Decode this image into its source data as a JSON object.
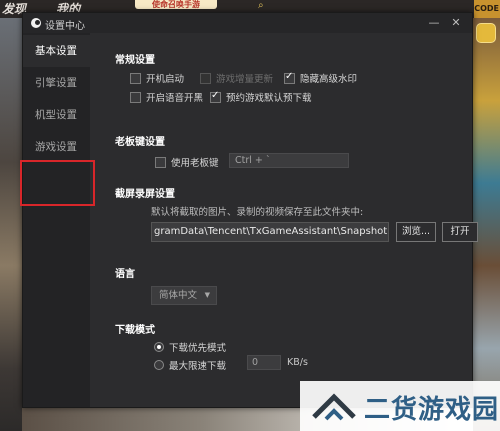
{
  "background": {
    "nav_items": [
      "发现",
      "我的"
    ],
    "banner": "使命召唤手游",
    "search_icon": "search-icon",
    "corner_logo": "CODE"
  },
  "window": {
    "title": "设置中心",
    "min_icon": "minimize-icon",
    "close_icon": "close-icon"
  },
  "sidebar": {
    "items": [
      {
        "label": "基本设置",
        "active": true
      },
      {
        "label": "引擎设置",
        "active": false
      },
      {
        "label": "机型设置",
        "active": false
      },
      {
        "label": "游戏设置",
        "active": false
      }
    ],
    "highlight_color": "#d8262a"
  },
  "general": {
    "title": "常规设置",
    "options": [
      {
        "label": "开机启动",
        "checked": false,
        "disabled": false
      },
      {
        "label": "游戏增量更新",
        "checked": false,
        "disabled": true
      },
      {
        "label": "隐藏高级水印",
        "checked": true,
        "disabled": false
      },
      {
        "label": "开启语音开黑",
        "checked": false,
        "disabled": false
      },
      {
        "label": "预约游戏默认预下载",
        "checked": true,
        "disabled": false
      }
    ]
  },
  "boss_key": {
    "title": "老板键设置",
    "checkbox_label": "使用老板键",
    "checked": false,
    "hotkey_value": "Ctrl + `"
  },
  "capture": {
    "title": "截屏录屏设置",
    "hint": "默认将截取的图片、录制的视频保存至此文件夹中:",
    "path": "gramData\\Tencent\\TxGameAssistant\\Snapshot",
    "browse_label": "浏览...",
    "open_label": "打开"
  },
  "language": {
    "title": "语言",
    "selected": "简体中文"
  },
  "download": {
    "title": "下载模式",
    "modes": [
      {
        "label": "下载优先模式",
        "checked": true
      },
      {
        "label": "最大限速下载",
        "checked": false
      }
    ],
    "speed_value": "0",
    "speed_unit": "KB/s"
  },
  "watermark": {
    "text": "二货游戏园",
    "color": "#2f5f86"
  }
}
